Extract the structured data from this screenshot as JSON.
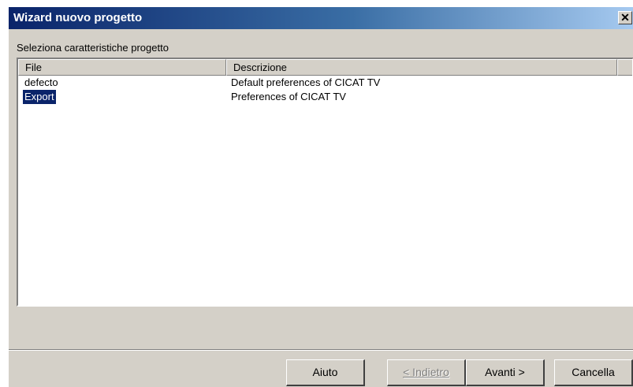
{
  "window": {
    "title": "Wizard nuovo progetto",
    "close_glyph": "✕"
  },
  "group_label": "Seleziona caratteristiche progetto",
  "list": {
    "columns": [
      "File",
      "Descrizione"
    ],
    "rows": [
      {
        "file": "defecto",
        "description": "Default preferences of CICAT TV",
        "selected": false
      },
      {
        "file": "Export",
        "description": "Preferences of CICAT TV",
        "selected": true
      }
    ]
  },
  "buttons": {
    "help": "Aiuto",
    "back": "< Indietro",
    "next": "Avanti >",
    "cancel": "Cancella"
  },
  "colors": {
    "title_bar": "#0a246a",
    "selection": "#0a246a",
    "dialog_bg": "#d4d0c8"
  }
}
